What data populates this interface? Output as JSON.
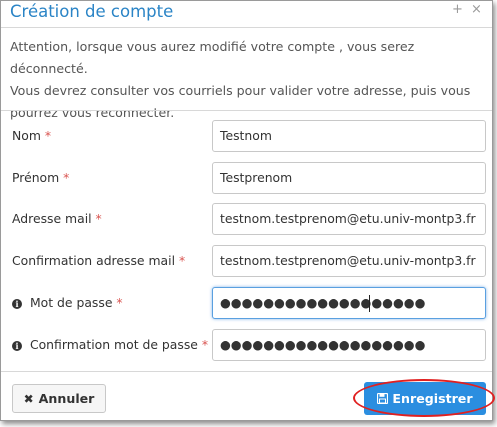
{
  "dialog": {
    "title": "Création de compte",
    "plus_icon": "+",
    "close_icon": "×"
  },
  "intro": {
    "line1": "Attention, lorsque vous aurez modifié votre compte , vous serez déconnecté.",
    "line2": "Vous devrez consulter vos courriels pour valider votre adresse, puis vous",
    "line3": "pourrez vous reconnecter."
  },
  "form": {
    "required_marker": "*",
    "fields": [
      {
        "label": "Nom",
        "value": "Testnom"
      },
      {
        "label": "Prénom",
        "value": "Testprenom"
      },
      {
        "label": "Adresse mail",
        "value": "testnom.testprenom@etu.univ-montp3.fr"
      },
      {
        "label": "Confirmation adresse mail",
        "value": "testnom.testprenom@etu.univ-montp3.fr"
      },
      {
        "label": "Mot de passe",
        "value": "●●●●●●●●●●●●●●●●●●●"
      },
      {
        "label": "Confirmation mot de passe",
        "value": "●●●●●●●●●●●●●●●●●●●"
      }
    ],
    "info_icon": "i"
  },
  "buttons": {
    "cancel_label": "Annuler",
    "cancel_icon": "✖",
    "save_label": "Enregistrer"
  },
  "colors": {
    "accent": "#2b8ee0",
    "title": "#2a84c6",
    "required": "#d9534f",
    "highlight_ellipse": "#e02020"
  }
}
